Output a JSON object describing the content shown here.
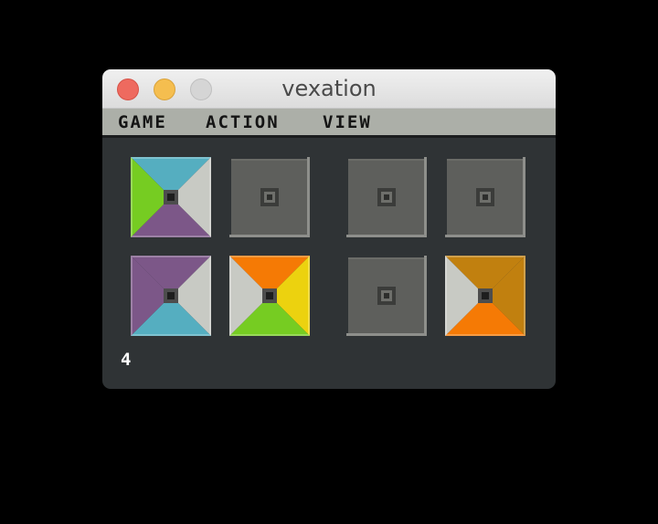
{
  "window": {
    "title": "vexation"
  },
  "menu": {
    "items": [
      "GAME",
      "ACTION",
      "VIEW"
    ]
  },
  "colors": {
    "teal": "#55aec0",
    "green": "#76cc22",
    "purple": "#7c5788",
    "grey": "#c8cac4",
    "orange": "#f57a05",
    "yellow": "#ecd20f",
    "amber": "#c1800f",
    "empty": "#5e5f5c"
  },
  "board": {
    "rows": [
      [
        {
          "top": "teal",
          "right": "grey",
          "bottom": "purple",
          "left": "green"
        },
        null,
        null,
        null
      ],
      [
        {
          "top": "purple",
          "right": "grey",
          "bottom": "teal",
          "left": "purple"
        },
        {
          "top": "orange",
          "right": "yellow",
          "bottom": "green",
          "left": "grey"
        },
        null,
        {
          "top": "amber",
          "right": "amber",
          "bottom": "orange",
          "left": "grey"
        }
      ]
    ]
  },
  "status": {
    "moves": "4"
  }
}
